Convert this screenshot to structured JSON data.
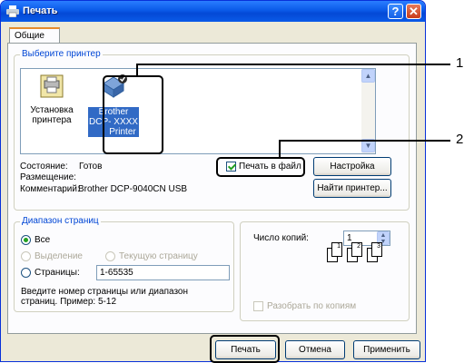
{
  "window": {
    "title": "Печать",
    "help_glyph": "?",
    "close_glyph": "✕"
  },
  "tabs": [
    {
      "label": "Общие"
    }
  ],
  "printer_group": {
    "legend": "Выберите принтер",
    "printers": [
      {
        "label_lines": [
          "Установка",
          "принтера"
        ],
        "icon": "add-printer-icon",
        "selected": false
      },
      {
        "label_lines": [
          "Brother",
          "DCP- XXXX",
          "Printer"
        ],
        "icon": "printer-icon",
        "selected": true
      }
    ],
    "status_label": "Состояние:",
    "status_value": "Готов",
    "location_label": "Размещение:",
    "comment_label": "Комментарий:",
    "comment_value": "Brother DCP-9040CN USB",
    "print_to_file_label": "Печать в файл",
    "print_to_file_checked": true,
    "settings_button": "Настройка",
    "find_printer_button": "Найти принтер..."
  },
  "range_group": {
    "legend": "Диапазон страниц",
    "all_label": "Все",
    "all_selected": true,
    "selection_label": "Выделение",
    "current_page_label": "Текущую страницу",
    "pages_label": "Страницы:",
    "pages_value": "1-65535",
    "hint": "Введите номер страницы или диапазон страниц. Пример: 5-12"
  },
  "copies_group": {
    "copies_label": "Число копий:",
    "copies_value": "1",
    "collate_label": "Разобрать по копиям",
    "collate_checked": false,
    "pages_glyphs": [
      "1",
      "1",
      "2",
      "2",
      "3",
      "3"
    ]
  },
  "footer_buttons": {
    "print": "Печать",
    "cancel": "Отмена",
    "apply": "Применить"
  },
  "annotations": {
    "callout_1": "1",
    "callout_2": "2"
  },
  "colors": {
    "titlebar": "#0a5ae8",
    "selection": "#316ac5",
    "legend_text": "#0046d5",
    "check_green": "#21a121"
  }
}
